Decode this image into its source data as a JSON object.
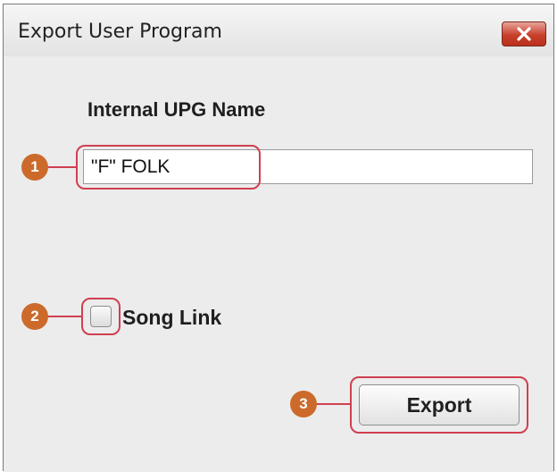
{
  "window": {
    "title": "Export User Program"
  },
  "form": {
    "name_label": "Internal UPG Name",
    "name_value": "\"F\" FOLK",
    "song_link_label": "Song Link",
    "song_link_checked": false,
    "export_label": "Export"
  },
  "callouts": {
    "one": "1",
    "two": "2",
    "three": "3"
  },
  "colors": {
    "callout_fill": "#cc6a2c",
    "highlight_outline": "#d04050",
    "close_button": "#c8402c"
  },
  "icons": {
    "close": "close-x-icon"
  }
}
